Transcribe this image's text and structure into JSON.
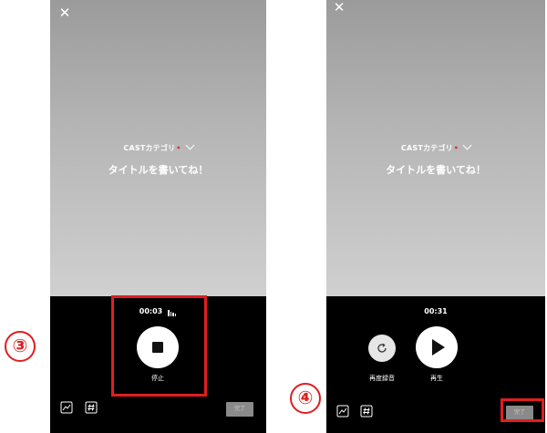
{
  "colors": {
    "highlight": "#e01e1e",
    "panel_bg": "#000000",
    "required_mark": "#e0302a",
    "done_button_bg": "#8a8a8a"
  },
  "left_screen": {
    "close_icon": "close-icon",
    "category_label": "CASTカテゴリ",
    "required_mark": "•",
    "title_placeholder": "タイトルを書いてね！",
    "timer": "00:03",
    "stop_label": "停止",
    "done_label": "完了",
    "step_number": "③"
  },
  "right_screen": {
    "close_icon": "close-icon",
    "category_label": "CASTカテゴリ",
    "required_mark": "•",
    "title_placeholder": "タイトルを書いてね！",
    "timer": "00:31",
    "rerecord_label": "再度録音",
    "play_label": "再生",
    "done_label": "完了",
    "step_number": "④"
  }
}
